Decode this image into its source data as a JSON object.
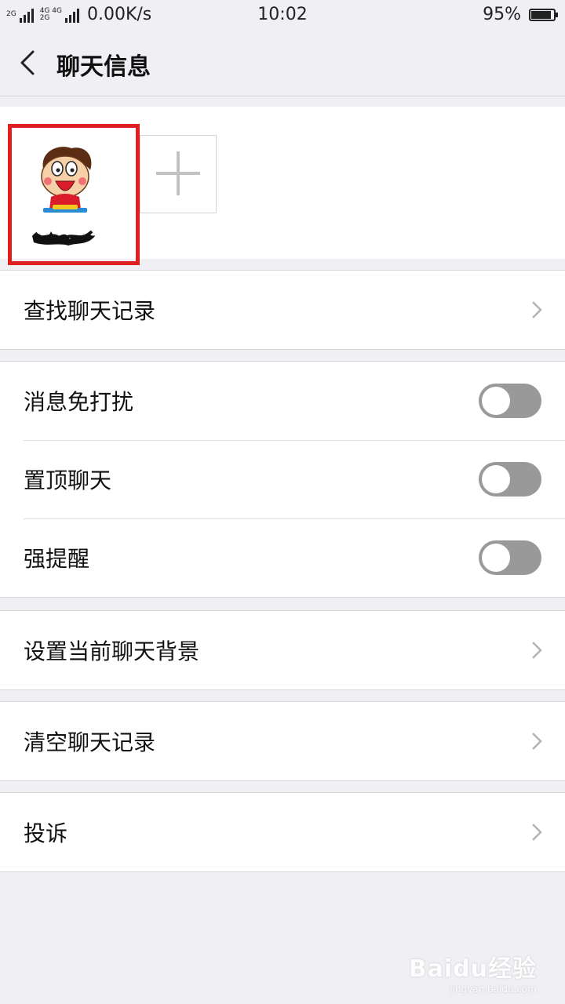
{
  "status_bar": {
    "net_left": "2G",
    "net_mid_top": "4G 4G",
    "net_mid_bottom": "2G",
    "speed": "0.00K/s",
    "time": "10:02",
    "battery": "95%",
    "battery_level": 0.95
  },
  "header": {
    "title": "聊天信息"
  },
  "settings": {
    "search_history": "查找聊天记录",
    "mute": "消息免打扰",
    "pin": "置顶聊天",
    "alert": "强提醒",
    "background": "设置当前聊天背景",
    "clear_history": "清空聊天记录",
    "report": "投诉"
  },
  "watermark": {
    "brand": "Baidu经验",
    "url": "jingyan.baidu.com"
  },
  "colors": {
    "highlight": "#e02020",
    "toggle_off": "#999999",
    "page_bg": "#efeff4"
  }
}
